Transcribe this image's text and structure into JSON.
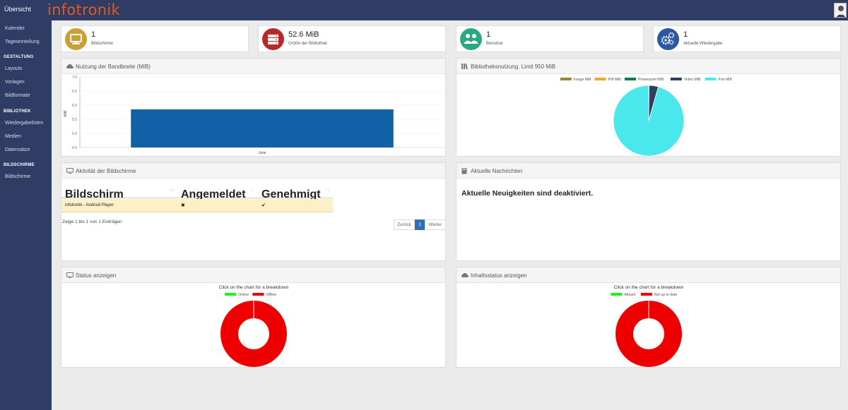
{
  "topbar": {
    "home": "Übersicht",
    "logo": "infotronik"
  },
  "sidebar": {
    "items": [
      {
        "label": "Kalender"
      },
      {
        "label": "Tageseinteilung"
      },
      {
        "label": "GESTALTUNG",
        "heading": true
      },
      {
        "label": "Layouts"
      },
      {
        "label": "Vorlagen"
      },
      {
        "label": "Bildformate"
      },
      {
        "label": "BIBLIOTHEK",
        "heading": true
      },
      {
        "label": "Wiedergabelisten"
      },
      {
        "label": "Medien"
      },
      {
        "label": "Datensätze"
      },
      {
        "label": "BILDSCHIRME",
        "heading": true
      },
      {
        "label": "Bildschirme"
      }
    ]
  },
  "stats": [
    {
      "value": "1",
      "label": "Bildschirme",
      "color": "#c8a033",
      "icon": "monitor-icon"
    },
    {
      "value": "52.6 MiB",
      "label": "Größe der Bibliothek",
      "color": "#b52b2b",
      "icon": "server-icon"
    },
    {
      "value": "1",
      "label": "Benutzer",
      "color": "#2aa87f",
      "icon": "users-icon"
    },
    {
      "value": "1",
      "label": "Aktuelle Wiedergabe",
      "color": "#2b57a3",
      "icon": "gears-icon"
    }
  ],
  "bandwidth": {
    "title": "Nutzung der Bandbreite (MiB)",
    "chart_data": {
      "type": "bar",
      "categories": [
        "June"
      ],
      "values": [
        5.85
      ],
      "ylabel": "MiB",
      "ylim": [
        4.5,
        7.0
      ],
      "yticks": [
        "7.0",
        "6.5",
        "6.0",
        "5.5",
        "5.0",
        "4.5"
      ],
      "color": "#1261a6"
    }
  },
  "library": {
    "title": "Bibliotheksnutzung. Limit 950 MiB",
    "chart_data": {
      "type": "pie",
      "labels": [
        "Image MiB",
        "Pdf MiB",
        "Powerpoint MiB",
        "Video MiB",
        "Frei MiB"
      ],
      "values": [
        0.5,
        0.3,
        0.6,
        40,
        897
      ],
      "colors": [
        "#a08336",
        "#f0a830",
        "#127a52",
        "#2e3f63",
        "#4ae8ec"
      ]
    }
  },
  "activity": {
    "title": "Aktivität der Bildschirme",
    "columns": [
      "Bildschirm",
      "Angemeldet",
      "Genehmigt"
    ],
    "rows": [
      {
        "name": "infotronik - Android Player",
        "logged_in": "✖",
        "approved": "✔"
      }
    ],
    "info": "Zeige 1 bis 1 von 1 Einträgen",
    "pager": {
      "prev": "Zurück",
      "page": "1",
      "next": "Weiter"
    }
  },
  "news": {
    "title": "Aktuelle Nachrichten",
    "message": "Aktuelle Neuigkeiten sind deaktiviert."
  },
  "status": {
    "title": "Status anzeigen",
    "hint": "Click on the chart for a breakdown",
    "chart_data": {
      "type": "pie",
      "labels": [
        "Online",
        "Offline"
      ],
      "values": [
        0,
        1
      ],
      "colors": [
        "#22ee22",
        "#ee0000"
      ]
    }
  },
  "content": {
    "title": "Inhaltsstatus anzeigen",
    "hint": "Click on the chart for a breakdown",
    "chart_data": {
      "type": "pie",
      "labels": [
        "Aktuell",
        "Not up to date"
      ],
      "values": [
        0,
        1
      ],
      "colors": [
        "#22ee22",
        "#ee0000"
      ]
    }
  }
}
